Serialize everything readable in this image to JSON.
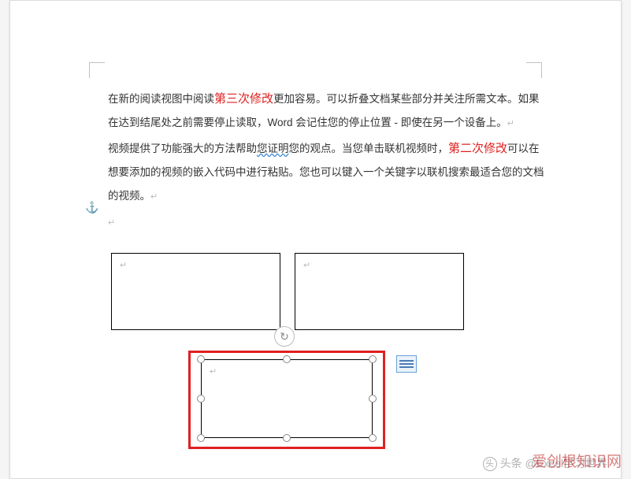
{
  "para1": {
    "t1": "在新的阅读视图中阅读",
    "edit": "第三次修改",
    "t2": "更加容易。可以折叠文档某些部分并关注所需文本。如果在达到结尾处之前需要停止读取，Word 会记住您的停止位置 ‑ 即使在另一个设备上。"
  },
  "para2": {
    "t1": "视频提供了功能强大的方法帮助",
    "wavy": "您证明",
    "t2": "您的观点。当您单击联机视频时，",
    "edit": "第二次修改",
    "t3": "可以在想要添加的视频的嵌入代码中进行粘贴。您也可以键入一个关键字以联机搜索最适合您的文档的视频。"
  },
  "marks": {
    "para": "↵",
    "anchor": "⚓"
  },
  "watermark1": "头条 @Excel学习世界",
  "watermark2": "爱创根知识网"
}
